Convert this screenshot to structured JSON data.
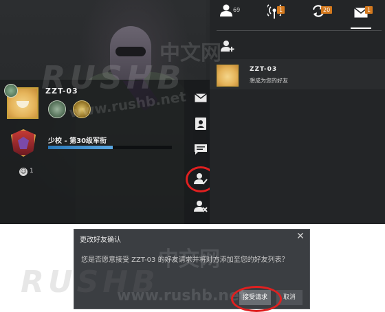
{
  "friends_panel": {
    "tabs": [
      {
        "name": "friends",
        "badge": "69"
      },
      {
        "name": "broadcast",
        "badge": "1"
      },
      {
        "name": "refresh",
        "badge": "20"
      },
      {
        "name": "messages",
        "badge": "1"
      }
    ],
    "requests": [
      {
        "name": "ZZT-03",
        "status": "想成为您的好友"
      }
    ]
  },
  "profile_card": {
    "name": "ZZT-03",
    "rank_title": "少校 - 第30级军衔",
    "xp_progress": 0.52,
    "commend_count": "1"
  },
  "action_menu": {
    "items": [
      "mail",
      "profile",
      "chat",
      "accept-friend",
      "remove-friend"
    ],
    "highlighted": "accept-friend"
  },
  "dialog": {
    "title": "更改好友确认",
    "close_glyph": "✕",
    "body": "您是否愿意接受 ZZT-03 的好友请求并将对方添加至您的好友列表？",
    "accept_label": "接受请求",
    "cancel_label": "取消"
  },
  "watermark": {
    "brand": "RUSHB",
    "cn": "中文网",
    "url": "www.rushb.net"
  },
  "colors": {
    "badge_orange": "#d4791e",
    "xp_blue": "#3a8fd0",
    "highlight_red": "#e02020"
  }
}
